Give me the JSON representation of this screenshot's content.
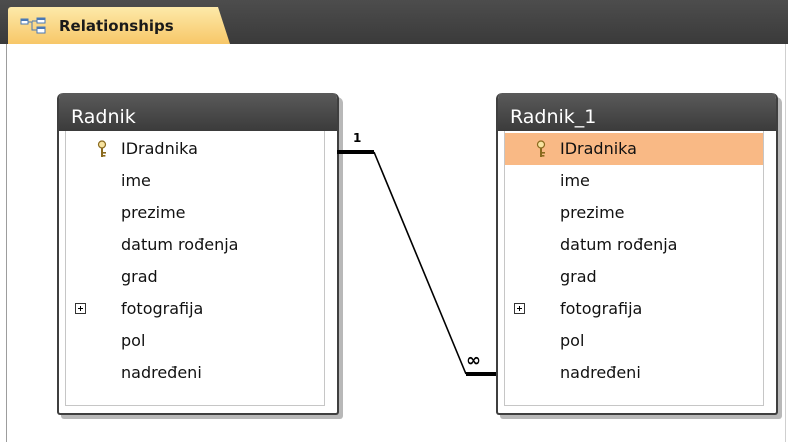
{
  "tab": {
    "label": "Relationships",
    "icon": "relationships-icon"
  },
  "tables": [
    {
      "title": "Radnik",
      "fields": [
        "IDradnika",
        "ime",
        "prezime",
        "datum rođenja",
        "grad",
        "fotografija",
        "pol",
        "nadređeni"
      ],
      "key_field": "IDradnika",
      "expandable_field": "fotografija",
      "selected_field": null
    },
    {
      "title": "Radnik_1",
      "fields": [
        "IDradnika",
        "ime",
        "prezime",
        "datum rođenja",
        "grad",
        "fotografija",
        "pol",
        "nadređeni"
      ],
      "key_field": "IDradnika",
      "expandable_field": "fotografija",
      "selected_field": "IDradnika"
    }
  ],
  "relationship": {
    "from_table": "Radnik",
    "from_field": "IDradnika",
    "to_table": "Radnik_1",
    "to_field": "nadređeni",
    "one_label": "1",
    "many_label": "∞"
  },
  "colors": {
    "tab_bar": "#3a3a3a",
    "tab": "#f7c768",
    "title_bar": "#454545",
    "selected_row": "#f9b985"
  }
}
